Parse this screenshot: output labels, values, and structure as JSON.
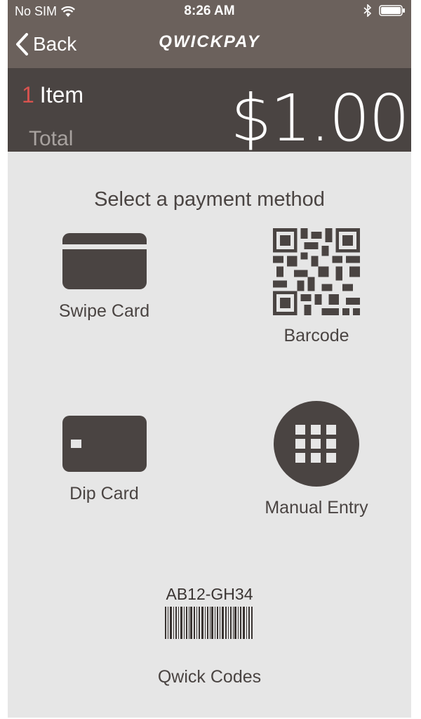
{
  "status_bar": {
    "carrier": "No SIM",
    "time": "8:26 AM"
  },
  "nav": {
    "back_label": "Back",
    "logo": "QWICKPAY"
  },
  "summary": {
    "item_count": "1",
    "item_label": "Item",
    "total_label": "Total",
    "total_amount": "$1.00"
  },
  "payment": {
    "prompt": "Select a payment method",
    "options": [
      {
        "label": "Swipe Card",
        "icon": "swipe-card-icon"
      },
      {
        "label": "Barcode",
        "icon": "qr-code-icon"
      },
      {
        "label": "Dip Card",
        "icon": "chip-card-icon"
      },
      {
        "label": "Manual Entry",
        "icon": "keypad-icon"
      }
    ]
  },
  "qwick_codes": {
    "code": "AB12-GH34",
    "label": "Qwick Codes"
  },
  "colors": {
    "bar": "#6b615c",
    "summary": "#4a4442",
    "accent": "#d9534f",
    "background": "#e6e6e6"
  }
}
